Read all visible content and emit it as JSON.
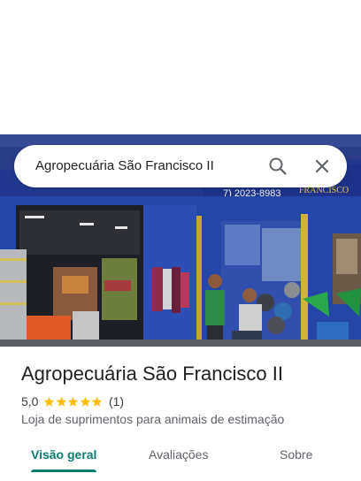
{
  "search": {
    "query": "Agropecuária São Francisco II",
    "search_icon": "search-icon",
    "close_icon": "close-icon"
  },
  "photo": {
    "sign_phone": "7) 2023-8983",
    "sign_brand": "FRANCISCO"
  },
  "place": {
    "name": "Agropecuária São Francisco II",
    "rating": "5,0",
    "stars": 5,
    "review_count": "(1)",
    "category": "Loja de suprimentos para animais de estimação"
  },
  "tabs": [
    {
      "label": "Visão geral",
      "active": true
    },
    {
      "label": "Avaliações",
      "active": false
    },
    {
      "label": "Sobre",
      "active": false
    }
  ],
  "colors": {
    "accent": "#0b7a71",
    "star": "#fbbc04",
    "storefront": "#2b3f8a"
  }
}
